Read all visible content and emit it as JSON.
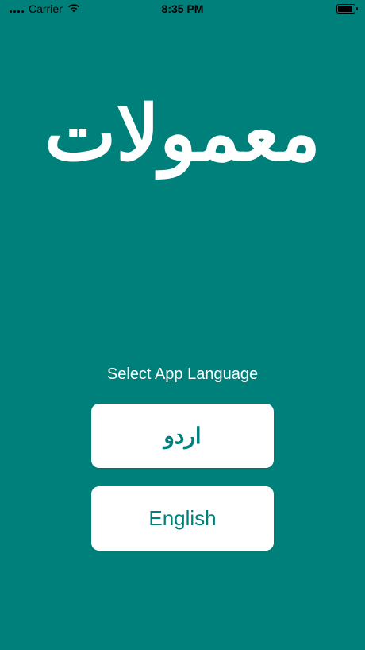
{
  "status_bar": {
    "carrier": "Carrier",
    "time": "8:35 PM"
  },
  "app": {
    "logo_text": "معمولات",
    "select_language_label": "Select App Language"
  },
  "buttons": {
    "urdu_label": "اردو",
    "english_label": "English"
  },
  "colors": {
    "background": "#00807a",
    "button_text": "#00807a",
    "button_background": "#ffffff"
  },
  "icons": [
    "signal-dots-icon",
    "wifi-icon",
    "battery-icon"
  ]
}
